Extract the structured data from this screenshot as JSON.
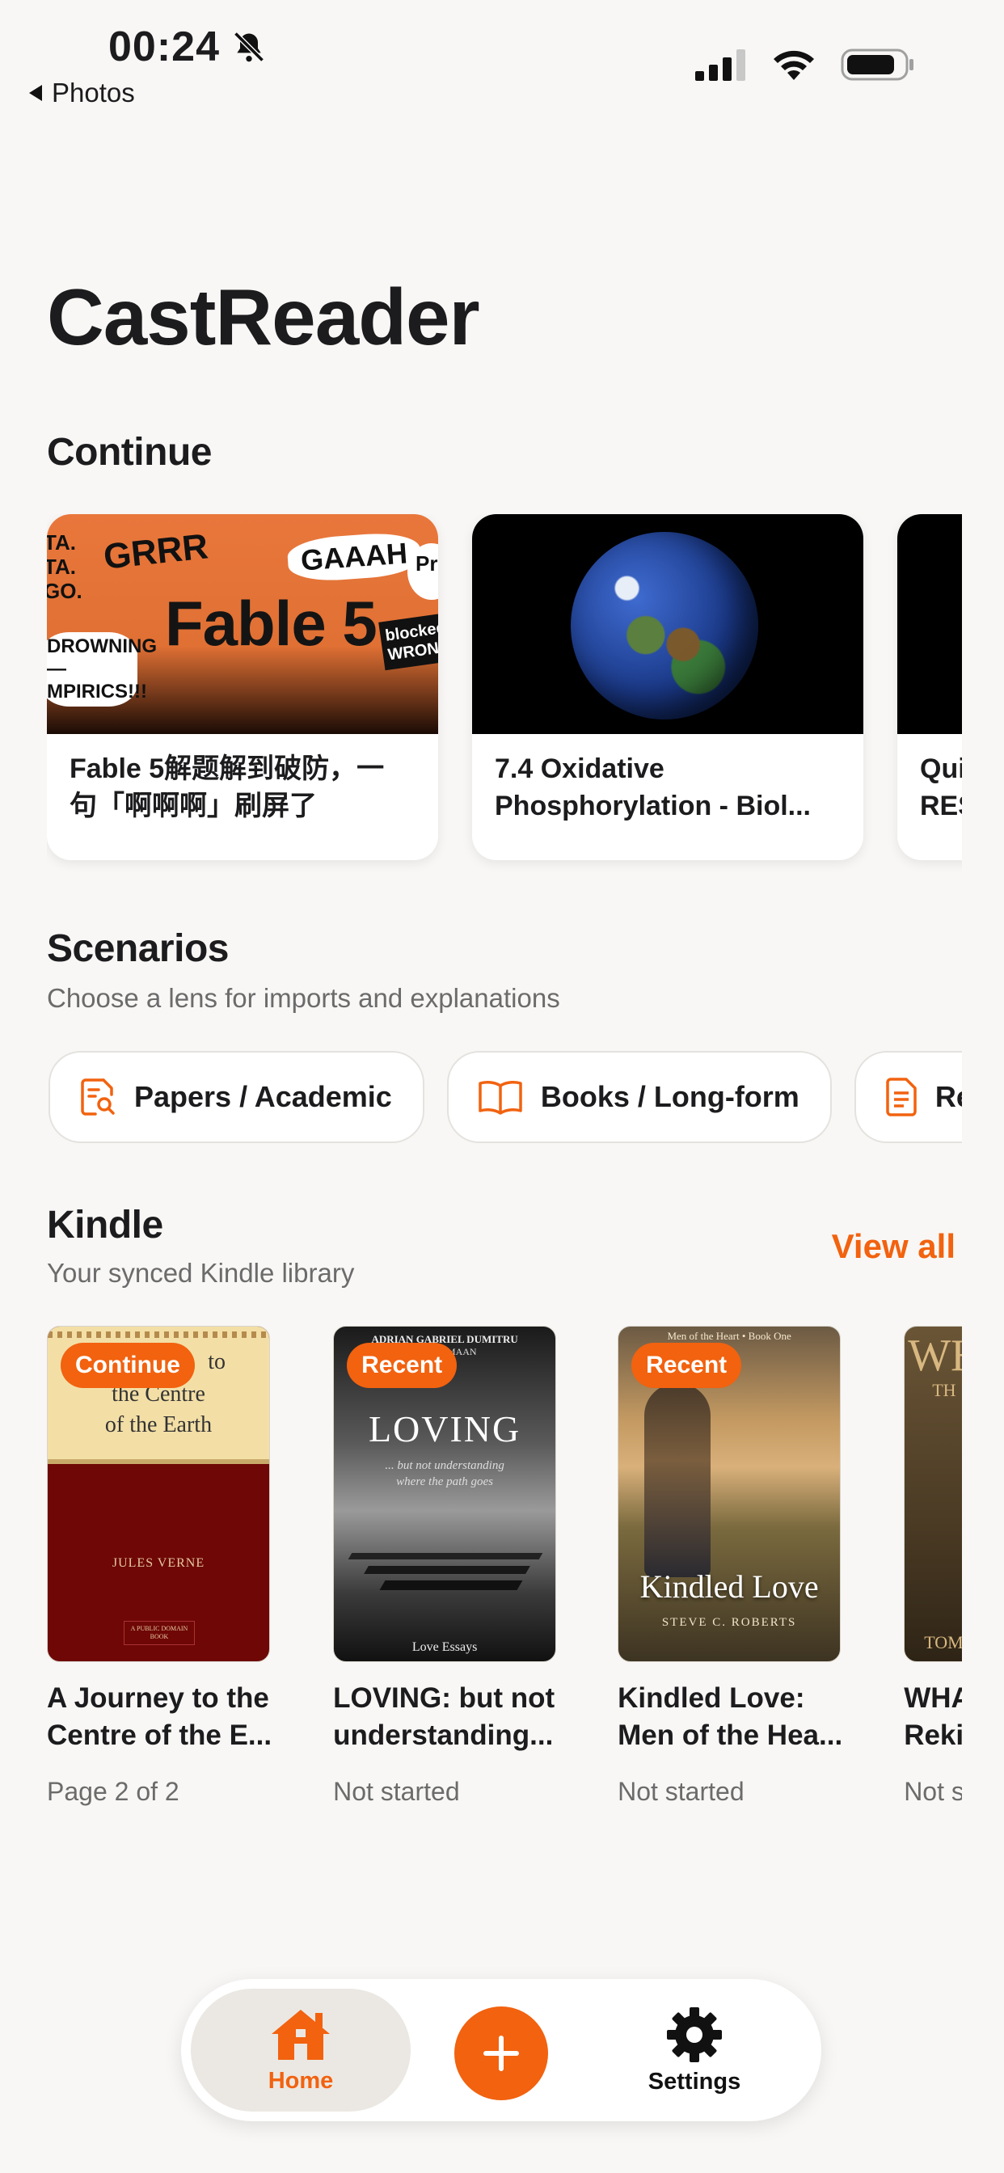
{
  "status_bar": {
    "time": "00:24",
    "back_label": "Photos",
    "mute_icon": "bell-slash-icon",
    "signal_icon": "cellular-signal-icon",
    "wifi_icon": "wifi-icon",
    "battery_icon": "battery-icon"
  },
  "app": {
    "title": "CastReader"
  },
  "continue": {
    "heading": "Continue",
    "cards": [
      {
        "line1": "Fable 5解题解到破防，一",
        "line2": "句「啊啊啊」刷屏了",
        "thumb": "Fable 5",
        "thumb_words": [
          "GRRR",
          "GAAAH",
          "TA. TA. GO.",
          "DROWNING— MPIRICS!!!",
          "blocked? WRON",
          "Pr"
        ]
      },
      {
        "line1": "7.4 Oxidative",
        "line2": "Phosphorylation - Biol..."
      },
      {
        "line1": "Qui",
        "line2": "RES"
      }
    ]
  },
  "scenarios": {
    "heading": "Scenarios",
    "subtitle": "Choose a lens for imports and explanations",
    "chips": [
      {
        "label": "Papers / Academic",
        "icon": "paper-search-icon"
      },
      {
        "label": "Books / Long-form",
        "icon": "open-book-icon"
      },
      {
        "label": "Re",
        "icon": "document-icon"
      }
    ]
  },
  "kindle": {
    "heading": "Kindle",
    "subtitle": "Your synced Kindle library",
    "view_all": "View all",
    "books": [
      {
        "badge": "Continue",
        "line1": "A Journey to the",
        "line2": "Centre of the E...",
        "status": "Page 2 of 2",
        "cover": {
          "title_tail": "to",
          "title2": "the Centre",
          "title3": "of the Earth",
          "author": "JULES VERNE",
          "footer": "A PUBLIC DOMAIN BOOK"
        }
      },
      {
        "badge": "Recent",
        "line1": "LOVING: but not",
        "line2": "understanding...",
        "status": "Not started",
        "cover": {
          "author": "ADRIAN GABRIEL DUMITRU",
          "author2": "ANA ESMAAN",
          "title": "LOVING",
          "tagline1": "... but not understanding",
          "tagline2": "where the path goes",
          "footer": "Love Essays"
        }
      },
      {
        "badge": "Recent",
        "line1": "Kindled Love:",
        "line2": "Men of the Hea...",
        "status": "Not started",
        "cover": {
          "series": "Men of the Heart • Book One",
          "title": "Kindled Love",
          "author": "STEVE C. ROBERTS"
        }
      },
      {
        "badge": "",
        "line1": "WHA",
        "line2": "Reki",
        "status": "Not s",
        "cover": {
          "title": "WH",
          "sub": "TH",
          "author": "TOM"
        }
      }
    ]
  },
  "tabbar": {
    "home_label": "Home",
    "settings_label": "Settings",
    "home_icon": "house-icon",
    "add_icon": "plus-icon",
    "settings_icon": "gear-icon"
  },
  "colors": {
    "accent": "#f2620f",
    "background": "#f8f7f5"
  }
}
